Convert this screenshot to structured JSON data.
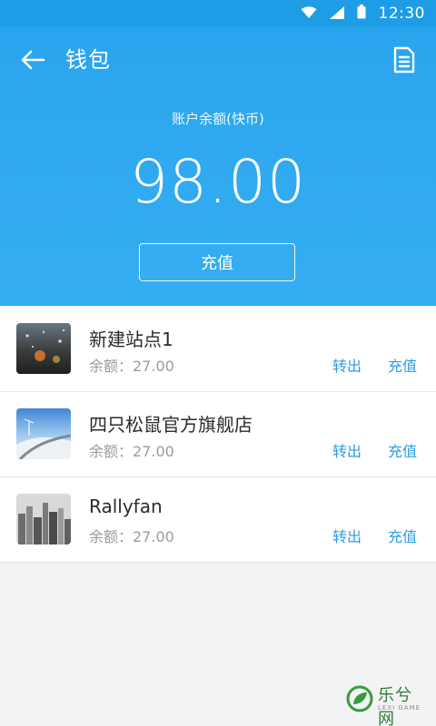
{
  "status_bar": {
    "time": "12:30",
    "icons": [
      "wifi-icon",
      "signal-icon",
      "battery-icon"
    ]
  },
  "header": {
    "title": "钱包",
    "balance_label": "账户余额(快币)",
    "balance_amount": "98.00",
    "recharge_label": "充值"
  },
  "list": [
    {
      "name": "新建站点1",
      "balance": "余额：27.00",
      "transfer_out": "转出",
      "recharge": "充值"
    },
    {
      "name": "四只松鼠官方旗舰店",
      "balance": "余额：27.00",
      "transfer_out": "转出",
      "recharge": "充值"
    },
    {
      "name": "Rallyfan",
      "balance": "余额：27.00",
      "transfer_out": "转出",
      "recharge": "充值"
    }
  ],
  "watermark": {
    "text": "乐兮网",
    "sub": "LEXI GAME"
  },
  "colors": {
    "header_bg": "#2aa4ee",
    "accent": "#2a9de3",
    "text_primary": "#2b2b2b",
    "text_secondary": "#9b9b9b",
    "page_bg": "#f2f3f5"
  }
}
